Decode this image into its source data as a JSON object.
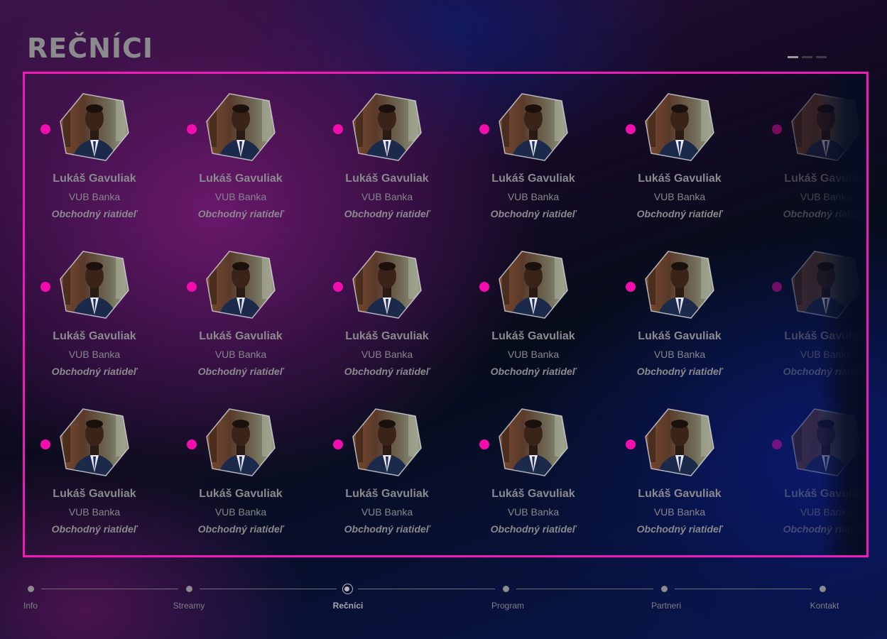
{
  "page": {
    "title": "REČNÍCI"
  },
  "pager": {
    "pages": 3,
    "active_index": 0
  },
  "speaker_card": {
    "name": "Lukáš Gavuliak",
    "company": "VUB Banka",
    "role": "Obchodný riatideľ"
  },
  "speakers_visible": {
    "rows": 3,
    "full_columns": 5,
    "partial_columns": 1
  },
  "timeline": {
    "steps": [
      {
        "label": "Info",
        "active": false
      },
      {
        "label": "Streamy",
        "active": false
      },
      {
        "label": "Rečníci",
        "active": true
      },
      {
        "label": "Program",
        "active": false
      },
      {
        "label": "Partneri",
        "active": false
      },
      {
        "label": "Kontakt",
        "active": false
      }
    ]
  },
  "colors": {
    "accent": "#f01ab9",
    "dot": "#f40dae",
    "text_muted": "#8a8a8f",
    "bg_purple": "#5a1a5e",
    "bg_navy": "#0a1650"
  },
  "icons": {
    "avatar": "hexagon-portrait-icon",
    "status": "pink-dot-icon",
    "timeline_node": "circle-node-icon"
  }
}
